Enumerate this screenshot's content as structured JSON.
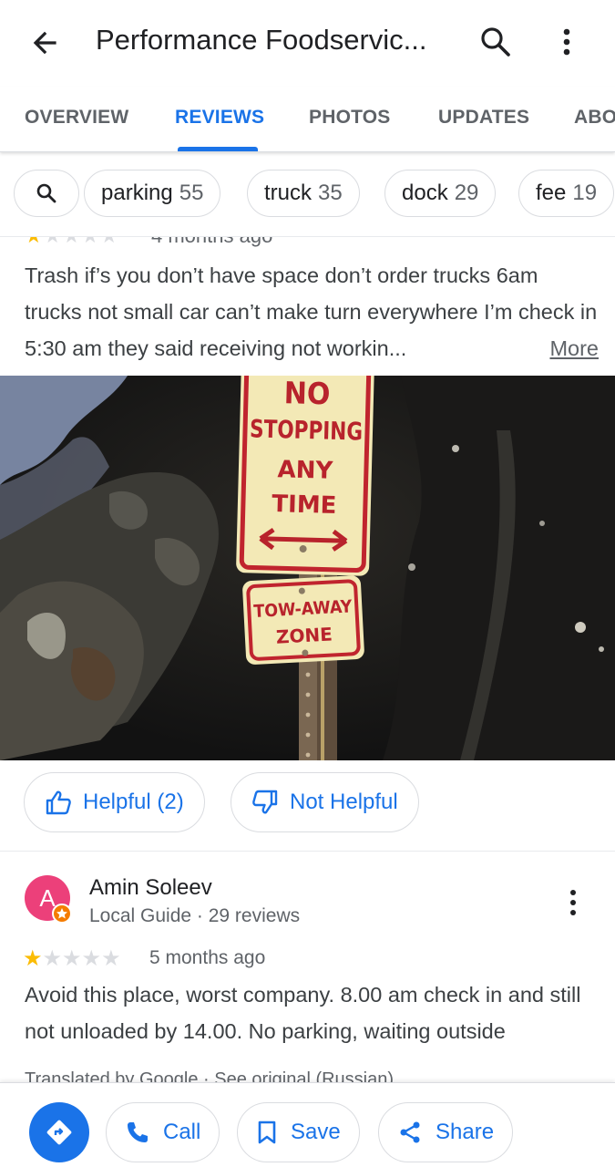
{
  "header": {
    "title": "Performance Foodservic...",
    "back_icon": "arrow-left-icon",
    "search_icon": "search-icon",
    "more_icon": "more-vert-icon"
  },
  "tabs": [
    {
      "label": "OVERVIEW",
      "active": false
    },
    {
      "label": "REVIEWS",
      "active": true
    },
    {
      "label": "PHOTOS",
      "active": false
    },
    {
      "label": "UPDATES",
      "active": false
    },
    {
      "label": "ABO",
      "active": false
    }
  ],
  "chips": [
    {
      "label": "parking",
      "count": "55"
    },
    {
      "label": "truck",
      "count": "35"
    },
    {
      "label": "dock",
      "count": "29"
    },
    {
      "label": "fee",
      "count": "19"
    }
  ],
  "review1": {
    "rating": 1,
    "time": "4 months ago",
    "text": "Trash if’s you don’t have space don’t order trucks 6am trucks not small car can’t make turn everywhere I’m check in 5:30 am they said receiving not workin...",
    "more_label": "More",
    "photo": {
      "sign_line1": "NO",
      "sign_line2": "STOPPING",
      "sign_line3": "ANY",
      "sign_line4": "TIME",
      "sign2_line1": "TOW-AWAY",
      "sign2_line2": "ZONE"
    },
    "helpful_label": "Helpful (2)",
    "not_helpful_label": "Not Helpful"
  },
  "review2": {
    "avatar_letter": "A",
    "name": "Amin Soleev",
    "meta": "Local Guide · 29 reviews",
    "rating": 1,
    "time": "5 months ago",
    "text": "Avoid this place, worst company. 8.00 am check in and still not unloaded by 14.00. No parking, waiting outside",
    "translated_by": "Translated by Google · ",
    "see_original": "See original (Russian)"
  },
  "actions": {
    "call_label": "Call",
    "save_label": "Save",
    "share_label": "Share"
  },
  "colors": {
    "accent": "#1a73e8",
    "star": "#fbbc04",
    "avatar": "#ec407a",
    "text_secondary": "#5f6368"
  }
}
